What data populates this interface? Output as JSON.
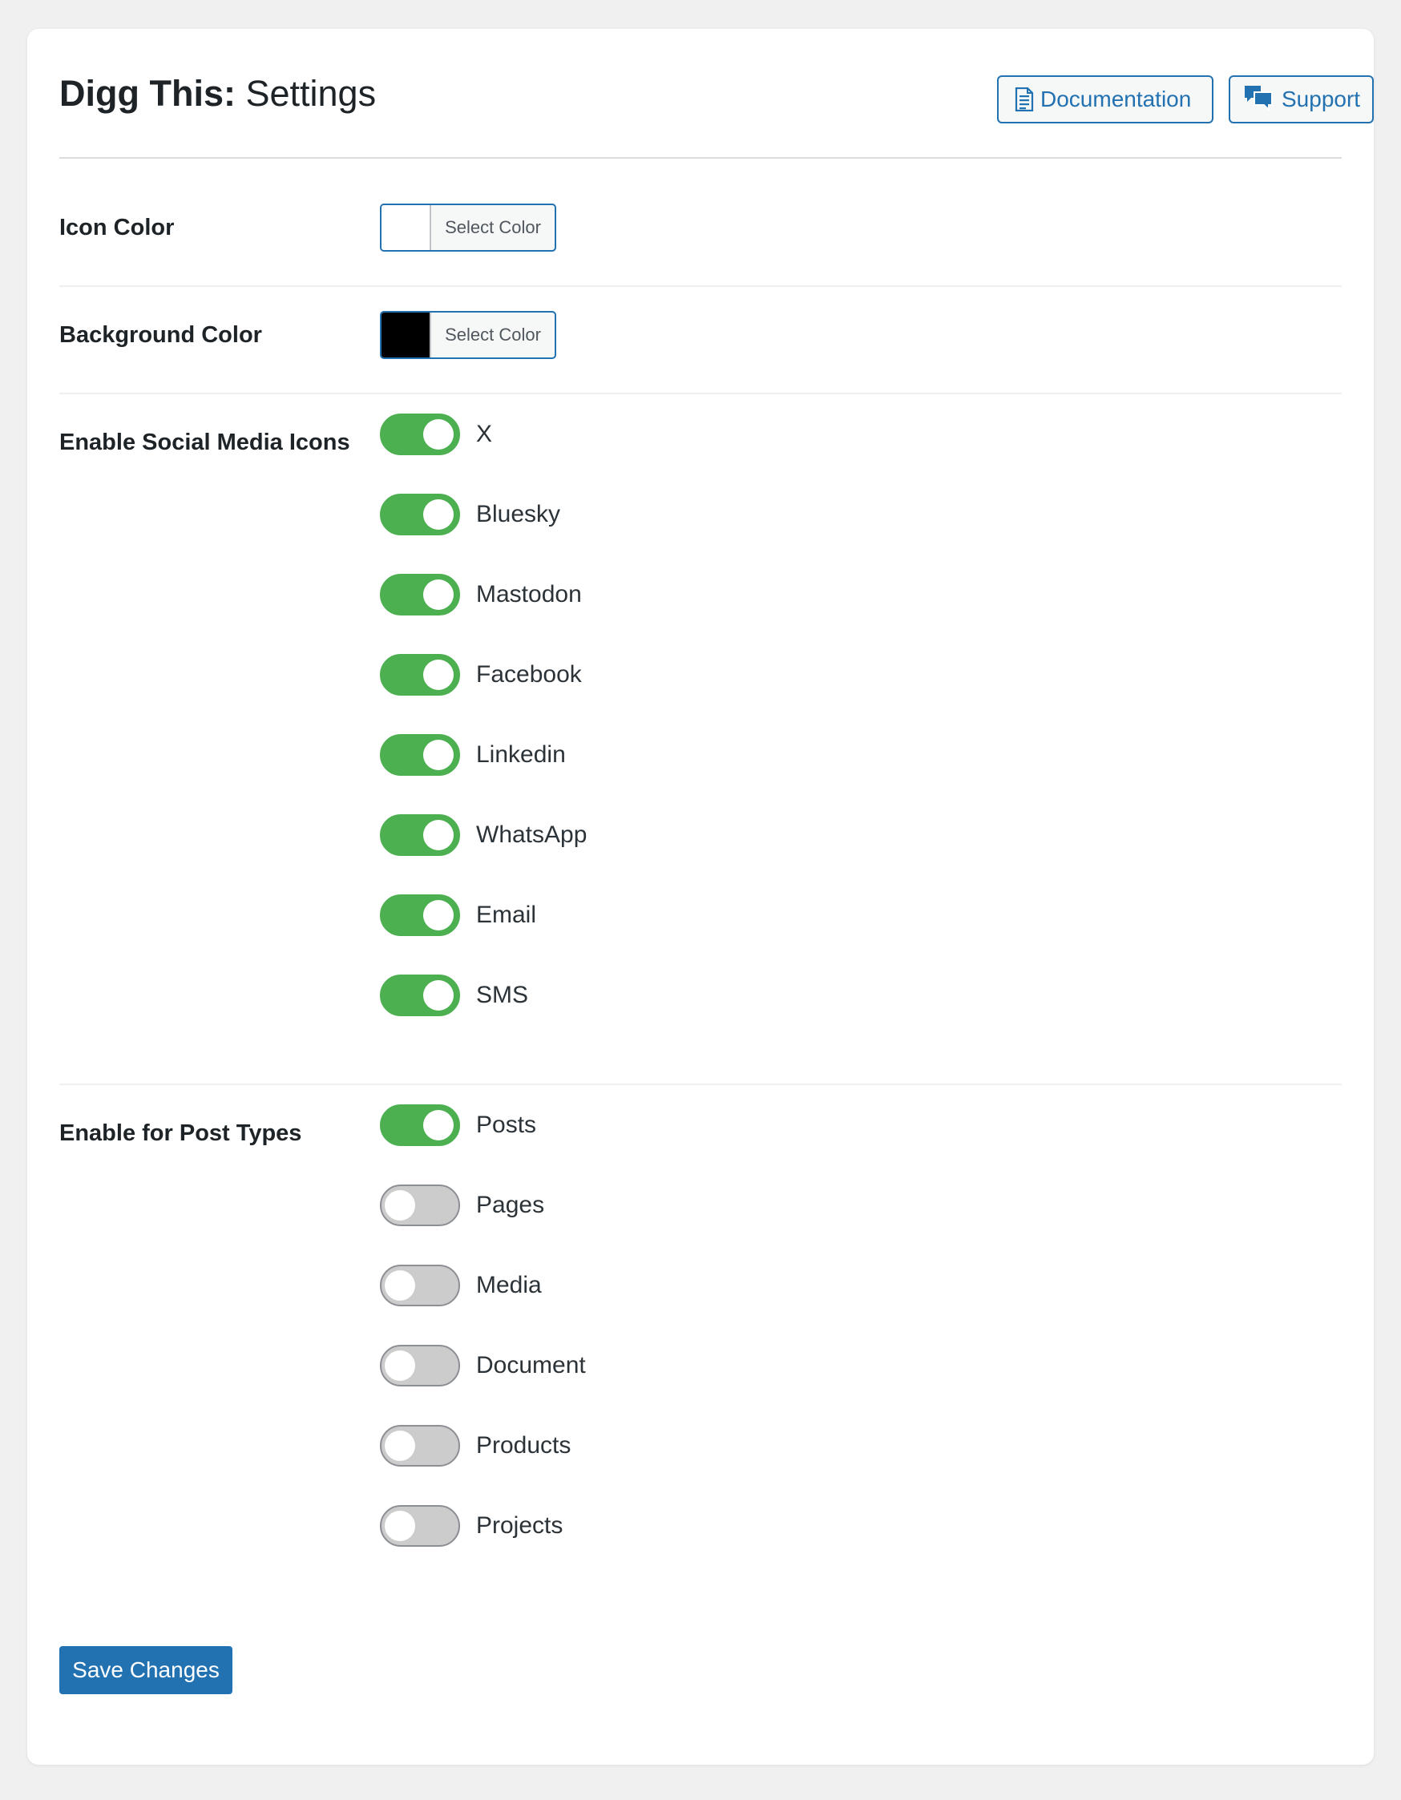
{
  "header": {
    "title_brand": "Digg This:",
    "title_page": "Settings",
    "documentation_label": "Documentation",
    "support_label": "Support"
  },
  "settings": {
    "icon_color": {
      "label": "Icon Color",
      "button_label": "Select Color",
      "value": "#ffffff"
    },
    "background_color": {
      "label": "Background Color",
      "button_label": "Select Color",
      "value": "#000000"
    },
    "social_icons": {
      "label": "Enable Social Media Icons",
      "items": [
        {
          "label": "X",
          "enabled": true
        },
        {
          "label": "Bluesky",
          "enabled": true
        },
        {
          "label": "Mastodon",
          "enabled": true
        },
        {
          "label": "Facebook",
          "enabled": true
        },
        {
          "label": "Linkedin",
          "enabled": true
        },
        {
          "label": "WhatsApp",
          "enabled": true
        },
        {
          "label": "Email",
          "enabled": true
        },
        {
          "label": "SMS",
          "enabled": true
        }
      ]
    },
    "post_types": {
      "label": "Enable for Post Types",
      "items": [
        {
          "label": "Posts",
          "enabled": true
        },
        {
          "label": "Pages",
          "enabled": false
        },
        {
          "label": "Media",
          "enabled": false
        },
        {
          "label": "Document",
          "enabled": false
        },
        {
          "label": "Products",
          "enabled": false
        },
        {
          "label": "Projects",
          "enabled": false
        }
      ]
    }
  },
  "save_label": "Save Changes",
  "colors": {
    "accent": "#2271b1",
    "toggle_on": "#4caf50",
    "toggle_off": "#cccccc"
  }
}
